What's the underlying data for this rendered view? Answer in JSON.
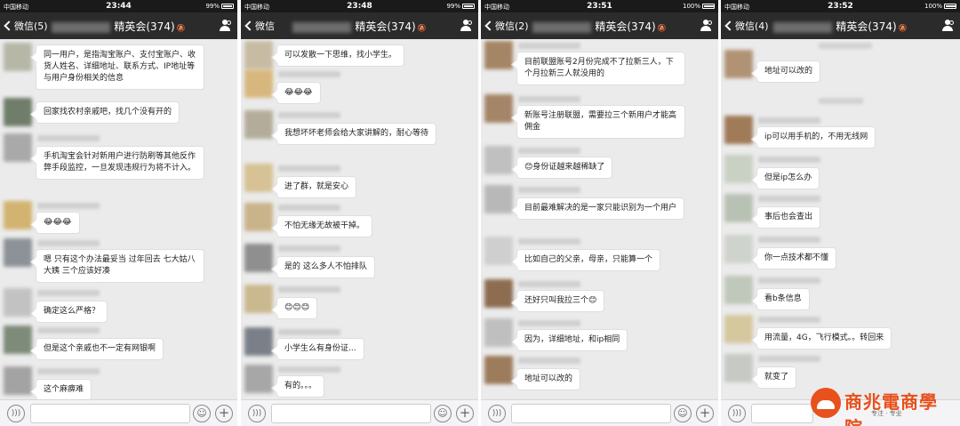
{
  "phones": [
    {
      "status": {
        "carrier": "中国移动",
        "time": "23:44",
        "battery": "99%"
      },
      "nav": {
        "back": "微信(5)",
        "title": "精英会(374)"
      },
      "messages": [
        {
          "text": "同一用户，是指淘宝账户、支付宝账户、收货人姓名、详细地址、联系方式、IP地址等与用户身份相关的信息",
          "avatar": "#b7b7a8"
        },
        {
          "text": "回家找农村亲戚吧，找几个没有开的",
          "avatar": "#6f7d6a"
        },
        {
          "text": "手机淘宝会针对新用户进行防刷等其他反作弊手段监控，一旦发现违规行为将不计入。",
          "avatar": "#a9a9a9"
        },
        {
          "text": "😂😂😂",
          "avatar": "#d2b470"
        },
        {
          "text": "嗯 只有这个办法最妥当 过年回去 七大姑八大姨 三个应该好凑",
          "avatar": "#8c9298"
        },
        {
          "text": "确定这么严格？",
          "avatar": "#c2c2c2"
        },
        {
          "text": "但是这个亲戚也不一定有网银啊",
          "avatar": "#7e8b79"
        },
        {
          "text": "这个麻痹难",
          "avatar": "#a3a3a3"
        }
      ]
    },
    {
      "status": {
        "carrier": "中国移动",
        "time": "23:48",
        "battery": "99%"
      },
      "nav": {
        "back": "微信",
        "title": "精英会(374)"
      },
      "messages": [
        {
          "text": "可以发散一下思维，找小学生。",
          "avatar": "#c7bba4"
        },
        {
          "text": "😂😂😂",
          "avatar": "#d7b77e"
        },
        {
          "text": "我想坏坏老师会给大家讲解的，耐心等待",
          "avatar": "#b4ac9a"
        },
        {
          "text": "进了群，就是安心",
          "avatar": "#d6c294"
        },
        {
          "text": "不怕无缘无故被干掉。",
          "avatar": "#c9b38a"
        },
        {
          "text": "是的 这么多人不怕排队",
          "avatar": "#8f8f8f"
        },
        {
          "text": "😊😊😊",
          "avatar": "#cab98f"
        },
        {
          "text": "小学生么有身份证...",
          "avatar": "#7b8088"
        },
        {
          "text": "有的。。。",
          "avatar": "#a7a7a7"
        }
      ]
    },
    {
      "status": {
        "carrier": "中国移动",
        "time": "23:51",
        "battery": "100%"
      },
      "nav": {
        "back": "微信(2)",
        "title": "精英会(374)"
      },
      "messages": [
        {
          "text": "目前联盟账号2月份完成不了拉新三人，下个月拉新三人就没用的",
          "avatar": "#a48565"
        },
        {
          "text": "新账号注册联盟，需要拉三个新用户才能高佣金",
          "avatar": "#a58567"
        },
        {
          "text": "😊身份证越来越稀缺了",
          "avatar": "#c0c0c0"
        },
        {
          "text": "目前最难解决的是一家只能识别为一个用户",
          "avatar": "#b8b8b8"
        },
        {
          "text": "比如自己的父亲，母亲，只能算一个",
          "avatar": "#cfcfcf"
        },
        {
          "text": "还好只叫我拉三个😊",
          "avatar": "#8d6c50"
        },
        {
          "text": "因为，详细地址，和ip相同",
          "avatar": "#bfbfbf"
        },
        {
          "text": "地址可以改的",
          "avatar": "#9d7b5d"
        }
      ]
    },
    {
      "status": {
        "carrier": "中国移动",
        "time": "23:52",
        "battery": "100%"
      },
      "nav": {
        "back": "微信(4)",
        "title": "精英会(374)"
      },
      "messages": [
        {
          "text": "地址可以改的",
          "avatar": "#b19275"
        },
        {
          "text": "ip可以用手机的，不用无线网",
          "avatar": "#9f7b58"
        },
        {
          "text": "但是ip怎么办",
          "avatar": "#c9d0c4"
        },
        {
          "text": "事后也会查出",
          "avatar": "#b8c2b4"
        },
        {
          "text": "你一点技术都不懂",
          "avatar": "#cfd3cd"
        },
        {
          "text": "看b条信息",
          "avatar": "#c0c8bb"
        },
        {
          "text": "用流量，4G，飞行模式。。转回来",
          "avatar": "#d5c79e"
        },
        {
          "text": "就变了",
          "avatar": "#c6c9c4"
        }
      ]
    }
  ],
  "logo": {
    "brand": "商兆電商學院",
    "slogan": "专注 · 专业"
  }
}
